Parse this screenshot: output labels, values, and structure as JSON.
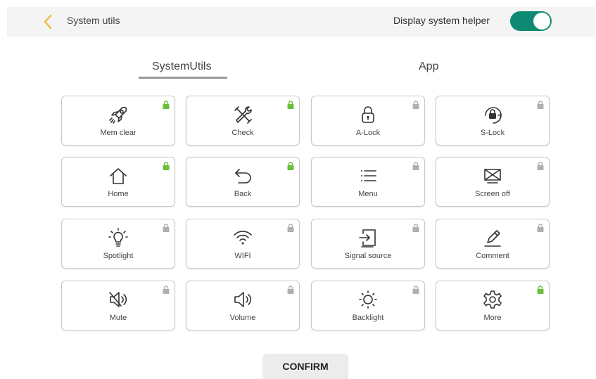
{
  "header": {
    "title": "System utils",
    "helper_label": "Display system helper",
    "helper_enabled": true,
    "accent_color": "#0e8a72",
    "back_color": "#f0b840"
  },
  "tabs": [
    {
      "label": "SystemUtils",
      "active": true
    },
    {
      "label": "App",
      "active": false
    }
  ],
  "tiles": [
    {
      "label": "Mem clear",
      "icon": "rocket-icon",
      "lock": "unlocked"
    },
    {
      "label": "Check",
      "icon": "tools-icon",
      "lock": "unlocked"
    },
    {
      "label": "A-Lock",
      "icon": "padlock-icon",
      "lock": "locked"
    },
    {
      "label": "S-Lock",
      "icon": "screen-rotation-lock-icon",
      "lock": "locked"
    },
    {
      "label": "Home",
      "icon": "home-icon",
      "lock": "unlocked"
    },
    {
      "label": "Back",
      "icon": "back-arrow-icon",
      "lock": "unlocked"
    },
    {
      "label": "Menu",
      "icon": "menu-icon",
      "lock": "locked"
    },
    {
      "label": "Screen off",
      "icon": "screen-off-icon",
      "lock": "locked"
    },
    {
      "label": "Spotlight",
      "icon": "spotlight-icon",
      "lock": "locked"
    },
    {
      "label": "WIFI",
      "icon": "wifi-icon",
      "lock": "locked"
    },
    {
      "label": "Signal source",
      "icon": "signal-source-icon",
      "lock": "locked"
    },
    {
      "label": "Comment",
      "icon": "pen-icon",
      "lock": "locked"
    },
    {
      "label": "Mute",
      "icon": "mute-icon",
      "lock": "locked"
    },
    {
      "label": "Volume",
      "icon": "volume-icon",
      "lock": "locked"
    },
    {
      "label": "Backlight",
      "icon": "backlight-icon",
      "lock": "locked"
    },
    {
      "label": "More",
      "icon": "gear-icon",
      "lock": "unlocked"
    }
  ],
  "lock_colors": {
    "unlocked": "#6cbf3a",
    "locked": "#b0b0b0"
  },
  "confirm_label": "CONFIRM"
}
